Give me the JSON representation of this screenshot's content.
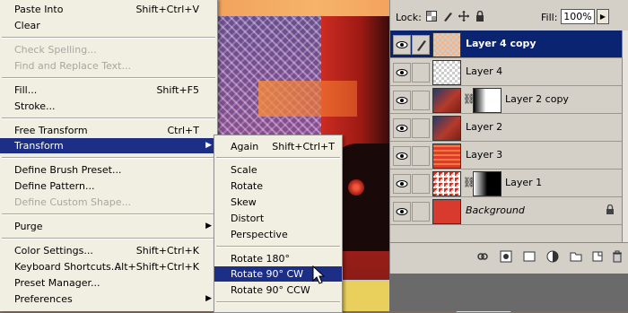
{
  "edit_menu": {
    "items": [
      {
        "label": "Paste Into",
        "shortcut": "Shift+Ctrl+V",
        "disabled": false
      },
      {
        "label": "Clear",
        "shortcut": "",
        "disabled": false
      },
      {
        "label": "Check Spelling...",
        "shortcut": "",
        "disabled": true
      },
      {
        "label": "Find and Replace Text...",
        "shortcut": "",
        "disabled": true
      },
      {
        "label": "Fill...",
        "shortcut": "Shift+F5",
        "disabled": false
      },
      {
        "label": "Stroke...",
        "shortcut": "",
        "disabled": false
      },
      {
        "label": "Free Transform",
        "shortcut": "Ctrl+T",
        "disabled": false
      },
      {
        "label": "Transform",
        "shortcut": "",
        "disabled": false,
        "active": true
      },
      {
        "label": "Define Brush Preset...",
        "shortcut": "",
        "disabled": false
      },
      {
        "label": "Define Pattern...",
        "shortcut": "",
        "disabled": false
      },
      {
        "label": "Define Custom Shape...",
        "shortcut": "",
        "disabled": true
      },
      {
        "label": "Purge",
        "shortcut": "",
        "disabled": false
      },
      {
        "label": "Color Settings...",
        "shortcut": "Shift+Ctrl+K",
        "disabled": false
      },
      {
        "label": "Keyboard Shortcuts...",
        "shortcut": "Alt+Shift+Ctrl+K",
        "disabled": false
      },
      {
        "label": "Preset Manager...",
        "shortcut": "",
        "disabled": false
      },
      {
        "label": "Preferences",
        "shortcut": "",
        "disabled": false
      }
    ]
  },
  "transform_submenu": {
    "items": [
      {
        "label": "Again",
        "shortcut": "Shift+Ctrl+T"
      },
      {
        "label": "Scale",
        "shortcut": ""
      },
      {
        "label": "Rotate",
        "shortcut": ""
      },
      {
        "label": "Skew",
        "shortcut": ""
      },
      {
        "label": "Distort",
        "shortcut": ""
      },
      {
        "label": "Perspective",
        "shortcut": ""
      },
      {
        "label": "Rotate 180°",
        "shortcut": ""
      },
      {
        "label": "Rotate 90° CW",
        "shortcut": "",
        "active": true
      },
      {
        "label": "Rotate 90° CCW",
        "shortcut": ""
      }
    ]
  },
  "layers_panel": {
    "lock_label": "Lock:",
    "fill_label": "Fill:",
    "fill_value": "100%",
    "layers": [
      {
        "name": "Layer 4 copy",
        "selected": true,
        "brush": true,
        "thumb": "checker-orange",
        "mask": false
      },
      {
        "name": "Layer 4",
        "selected": false,
        "thumb": "checker-orange",
        "mask": false
      },
      {
        "name": "Layer 2 copy",
        "selected": false,
        "thumb": "photo",
        "mask": true,
        "mask_style": "grad-white"
      },
      {
        "name": "Layer 2",
        "selected": false,
        "thumb": "photo",
        "mask": false
      },
      {
        "name": "Layer 3",
        "selected": false,
        "thumb": "red-stripes",
        "mask": false
      },
      {
        "name": "Layer 1",
        "selected": false,
        "thumb": "checker-red",
        "mask": true,
        "mask_style": "grad-black"
      },
      {
        "name": "Background",
        "selected": false,
        "thumb": "red",
        "mask": false,
        "locked": true,
        "italic": true
      }
    ]
  },
  "colors": {
    "menu_bg": "#f1efe2",
    "highlight": "#1c2e86",
    "panel_bg": "#d4d0c8",
    "selected_layer": "#0a2472"
  }
}
